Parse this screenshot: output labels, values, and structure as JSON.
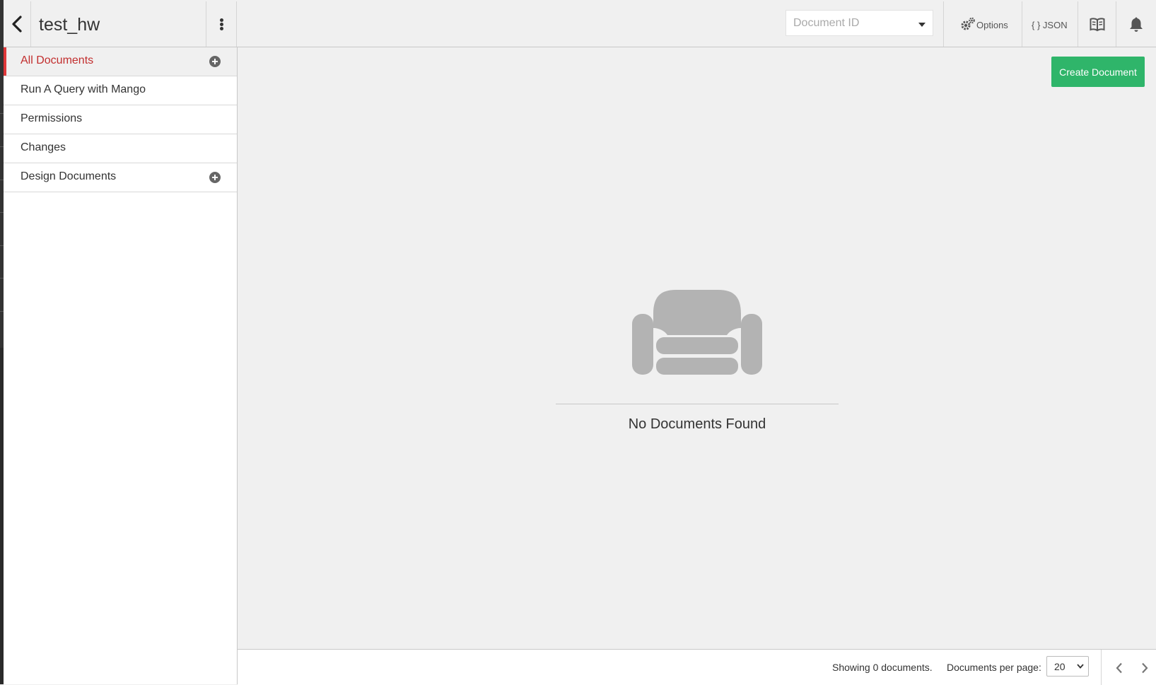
{
  "header": {
    "database_name": "test_hw",
    "document_id_placeholder": "Document ID",
    "options_label": "Options",
    "json_label": "{ } JSON",
    "icons": [
      "back-arrow-icon",
      "kebab-menu-icon",
      "gears-icon",
      "book-icon",
      "bell-icon",
      "caret-down-icon"
    ]
  },
  "sidebar": {
    "items": [
      {
        "label": "All Documents",
        "active": true,
        "has_add": true
      },
      {
        "label": "Run A Query with Mango",
        "active": false,
        "has_add": false
      },
      {
        "label": "Permissions",
        "active": false,
        "has_add": false
      },
      {
        "label": "Changes",
        "active": false,
        "has_add": false
      },
      {
        "label": "Design Documents",
        "active": false,
        "has_add": true
      }
    ]
  },
  "main": {
    "create_button_label": "Create Document",
    "empty_message": "No Documents Found",
    "empty_icon": "couch-icon"
  },
  "footer": {
    "showing_text": "Showing 0 documents.",
    "per_page_label": "Documents per page:",
    "per_page_value": "20"
  },
  "colors": {
    "accent_red": "#c22e2e",
    "active_bar": "#e0383a",
    "create_green": "#2fb56a",
    "background": "#f0f0f0",
    "couch_gray": "#b3b3b3"
  }
}
